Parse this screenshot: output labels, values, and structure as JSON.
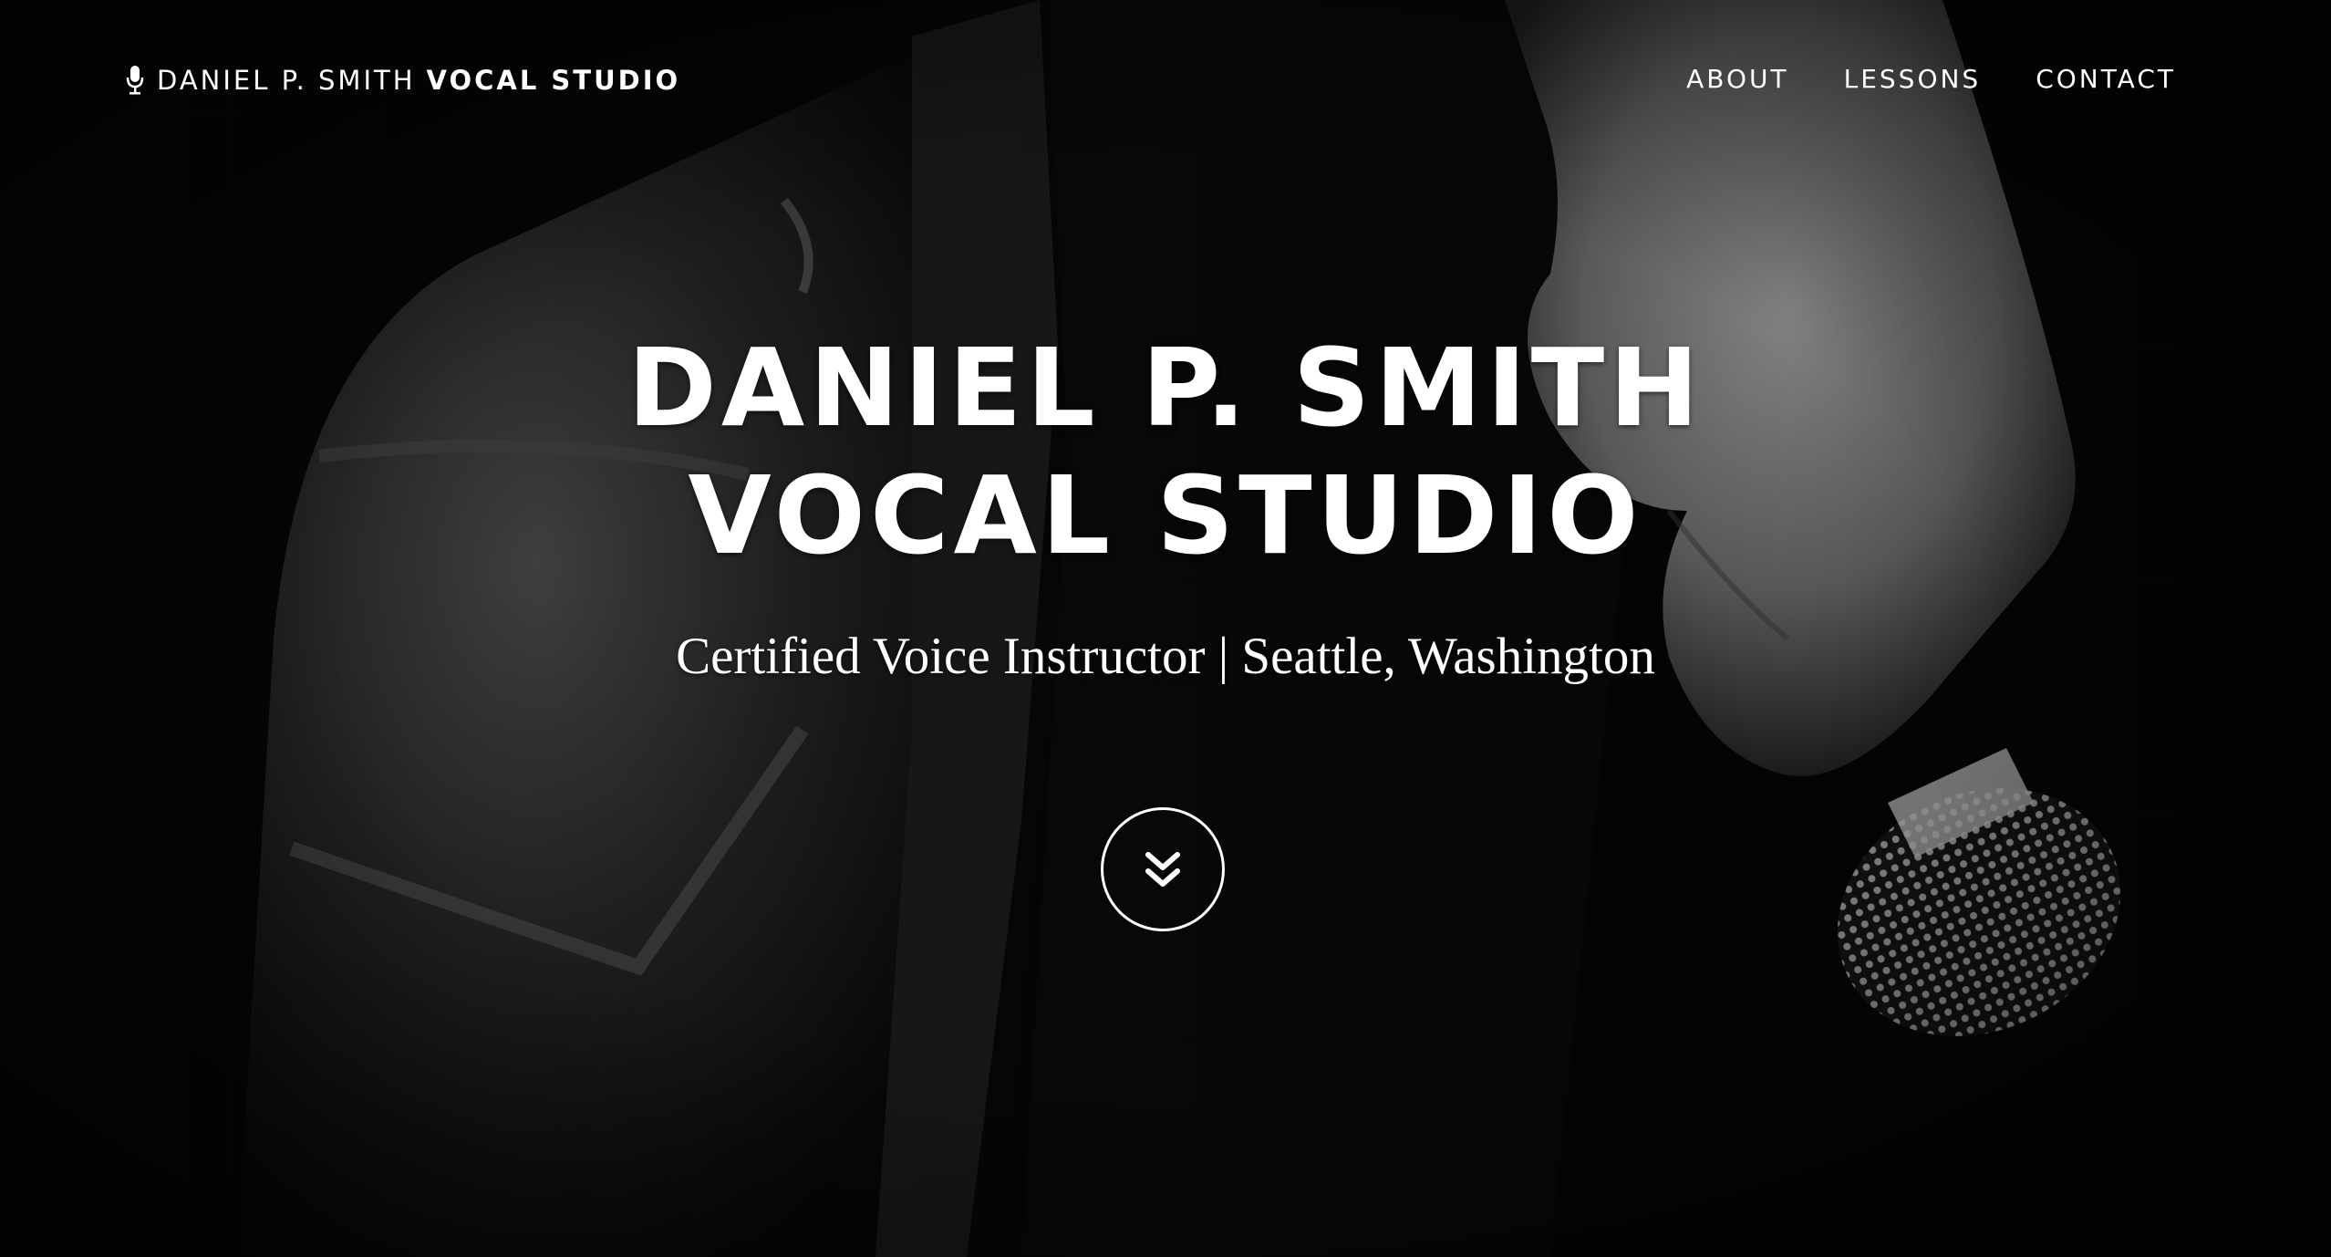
{
  "navbar": {
    "brand_light": "DANIEL P. SMITH",
    "brand_bold": "VOCAL STUDIO",
    "links": [
      {
        "label": "ABOUT"
      },
      {
        "label": "LESSONS"
      },
      {
        "label": "CONTACT"
      }
    ]
  },
  "hero": {
    "title_line1": "DANIEL P. SMITH",
    "title_line2": "VOCAL STUDIO",
    "tagline": "Certified Voice Instructor | Seattle, Washington",
    "scroll_icon": "double-chevron-down-icon"
  },
  "colors": {
    "text": "#ffffff",
    "background": "#050505"
  }
}
